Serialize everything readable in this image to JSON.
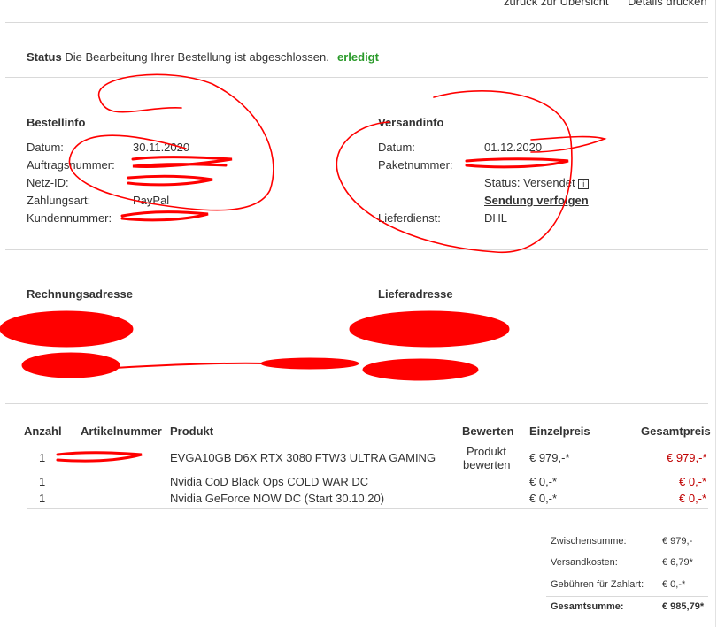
{
  "top_links": {
    "back": "zurück zur Übersicht",
    "print": "Details drucken"
  },
  "status": {
    "label": "Status",
    "text": "Die Bearbeitung Ihrer Bestellung ist abgeschlossen.",
    "value": "erledigt",
    "value_color": "#2a9a2a"
  },
  "bestellinfo": {
    "heading": "Bestellinfo",
    "rows": [
      {
        "label": "Datum:",
        "value": "30.11.2020"
      },
      {
        "label": "Auftragsnummer:",
        "value": ""
      },
      {
        "label": "Netz-ID:",
        "value": ""
      },
      {
        "label": "Zahlungsart:",
        "value": "PayPal"
      },
      {
        "label": "Kundennummer:",
        "value": ""
      }
    ]
  },
  "versandinfo": {
    "heading": "Versandinfo",
    "date_label": "Datum:",
    "date_value": "01.12.2020",
    "package_label": "Paketnummer:",
    "package_value": "",
    "status_text": "Status: Versendet",
    "info_icon": "info-icon",
    "tracking_link": "Sendung verfolgen",
    "carrier_label": "Lieferdienst:",
    "carrier_value": "DHL"
  },
  "addresses": {
    "billing_heading": "Rechnungsadresse",
    "shipping_heading": "Lieferadresse"
  },
  "table": {
    "headers": {
      "qty": "Anzahl",
      "article": "Artikelnummer",
      "product": "Produkt",
      "rate": "Bewerten",
      "unit": "Einzelpreis",
      "total": "Gesamtpreis"
    },
    "rows": [
      {
        "qty": "1",
        "article": "",
        "product": "EVGA10GB D6X RTX 3080 FTW3 ULTRA GAMING",
        "rate1": "Produkt",
        "rate2": "bewerten",
        "unit": "€ 979,-*",
        "total": "€ 979,-*"
      },
      {
        "qty": "1",
        "article": "",
        "product": "Nvidia CoD Black Ops COLD WAR DC",
        "unit": "€ 0,-*",
        "total": "€ 0,-*"
      },
      {
        "qty": "1",
        "article": "",
        "product": "Nvidia GeForce NOW DC (Start 30.10.20)",
        "unit": "€ 0,-*",
        "total": "€ 0,-*"
      }
    ],
    "price_color": "#c00000"
  },
  "summary": {
    "subtotal_label": "Zwischensumme:",
    "subtotal_value": "€ 979,-",
    "shipping_label": "Versandkosten:",
    "shipping_value": "€ 6,79*",
    "fee_label": "Gebühren für Zahlart:",
    "fee_value": "€ 0,-*",
    "total_label": "Gesamtsumme:",
    "total_value": "€ 985,79*"
  }
}
